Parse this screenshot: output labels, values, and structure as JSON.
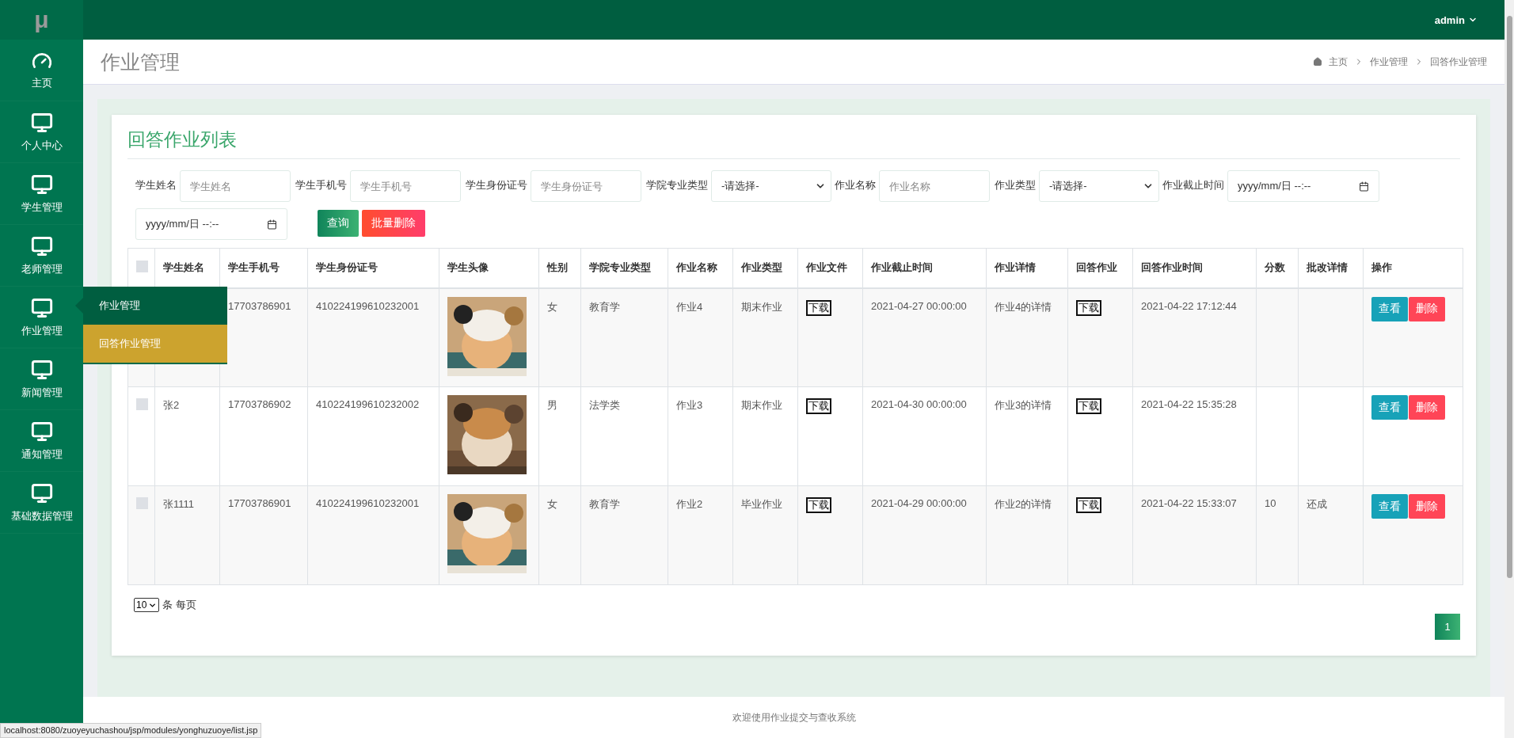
{
  "logo": "μ",
  "top_bar": {
    "user": "admin"
  },
  "sidebar": {
    "items": [
      {
        "label": "主页",
        "kind": "dashboard"
      },
      {
        "label": "个人中心",
        "kind": "monitor"
      },
      {
        "label": "学生管理",
        "kind": "monitor"
      },
      {
        "label": "老师管理",
        "kind": "monitor"
      },
      {
        "label": "作业管理",
        "kind": "monitor",
        "children": [
          {
            "label": "作业管理",
            "selected": false
          },
          {
            "label": "回答作业管理",
            "selected": true
          }
        ]
      },
      {
        "label": "新闻管理",
        "kind": "monitor"
      },
      {
        "label": "通知管理",
        "kind": "monitor"
      },
      {
        "label": "基础数据管理",
        "kind": "monitor"
      }
    ]
  },
  "page_header": {
    "title": "作业管理",
    "breadcrumb": [
      "主页",
      "作业管理",
      "回答作业管理"
    ]
  },
  "card": {
    "title": "回答作业列表",
    "filters": [
      {
        "label": "学生姓名",
        "kind": "text",
        "placeholder": "学生姓名"
      },
      {
        "label": "学生手机号",
        "kind": "text",
        "placeholder": "学生手机号"
      },
      {
        "label": "学生身份证号",
        "kind": "text",
        "placeholder": "学生身份证号"
      },
      {
        "label": "学院专业类型",
        "kind": "select",
        "value": "-请选择-"
      },
      {
        "label": "作业名称",
        "kind": "text",
        "placeholder": "作业名称"
      },
      {
        "label": "作业类型",
        "kind": "select",
        "value": "-请选择-"
      },
      {
        "label": "作业截止时间",
        "kind": "datetime",
        "value": "yyyy/mm/日  --:--"
      },
      {
        "kind": "datetime",
        "value": "yyyy/mm/日  --:--"
      }
    ],
    "buttons": [
      {
        "label": "查询",
        "kind": "search"
      },
      {
        "label": "批量删除",
        "kind": "delete"
      }
    ],
    "table": {
      "select_all": {
        "checked": false
      },
      "columns": [
        "学生姓名",
        "学生手机号",
        "学生身份证号",
        "学生头像",
        "性别",
        "学院专业类型",
        "作业名称",
        "作业类型",
        "作业文件",
        "作业截止时间",
        "作业详情",
        "回答作业",
        "回答作业时间",
        "分数",
        "批改详情",
        "操作"
      ],
      "rows": [
        {
          "phone": "17703786901",
          "id_number": "410224199610232001",
          "avatar": {
            "kind": "picture"
          },
          "gender": "女",
          "major": "教育学",
          "homework": "作业4",
          "homework_type": "期末作业",
          "file": "下载",
          "deadline": "2021-04-27 00:00:00",
          "detail": "作业4的详情",
          "answer": "下载",
          "answer_time": "2021-04-22 17:12:44",
          "actions": [
            "查看",
            "删除"
          ]
        },
        {
          "checked": false,
          "name": "张2",
          "phone": "17703786902",
          "id_number": "410224199610232002",
          "avatar": {
            "kind": "picture"
          },
          "gender": "男",
          "major": "法学类",
          "homework": "作业3",
          "homework_type": "期末作业",
          "file": "下载",
          "deadline": "2021-04-30 00:00:00",
          "detail": "作业3的详情",
          "answer": "下载",
          "answer_time": "2021-04-22 15:35:28",
          "actions": [
            "查看",
            "删除"
          ]
        },
        {
          "checked": false,
          "name": "张1111",
          "phone": "17703786901",
          "id_number": "410224199610232001",
          "avatar": {
            "kind": "picture"
          },
          "gender": "女",
          "major": "教育学",
          "homework": "作业2",
          "homework_type": "毕业作业",
          "file": "下载",
          "deadline": "2021-04-29 00:00:00",
          "detail": "作业2的详情",
          "answer": "下载",
          "answer_time": "2021-04-22 15:33:07",
          "score": "10",
          "review": "还成",
          "actions": [
            "查看",
            "删除"
          ]
        }
      ]
    },
    "pagination": {
      "page_size": "10",
      "page_size_label": "条 每页",
      "pages": [
        {
          "label": "1",
          "selected": true
        }
      ]
    }
  },
  "footer": "欢迎使用作业提交与查收系统",
  "status_bar": "localhost:8080/zuoyeyuchashou/jsp/modules/yonghuzuoye/list.jsp"
}
